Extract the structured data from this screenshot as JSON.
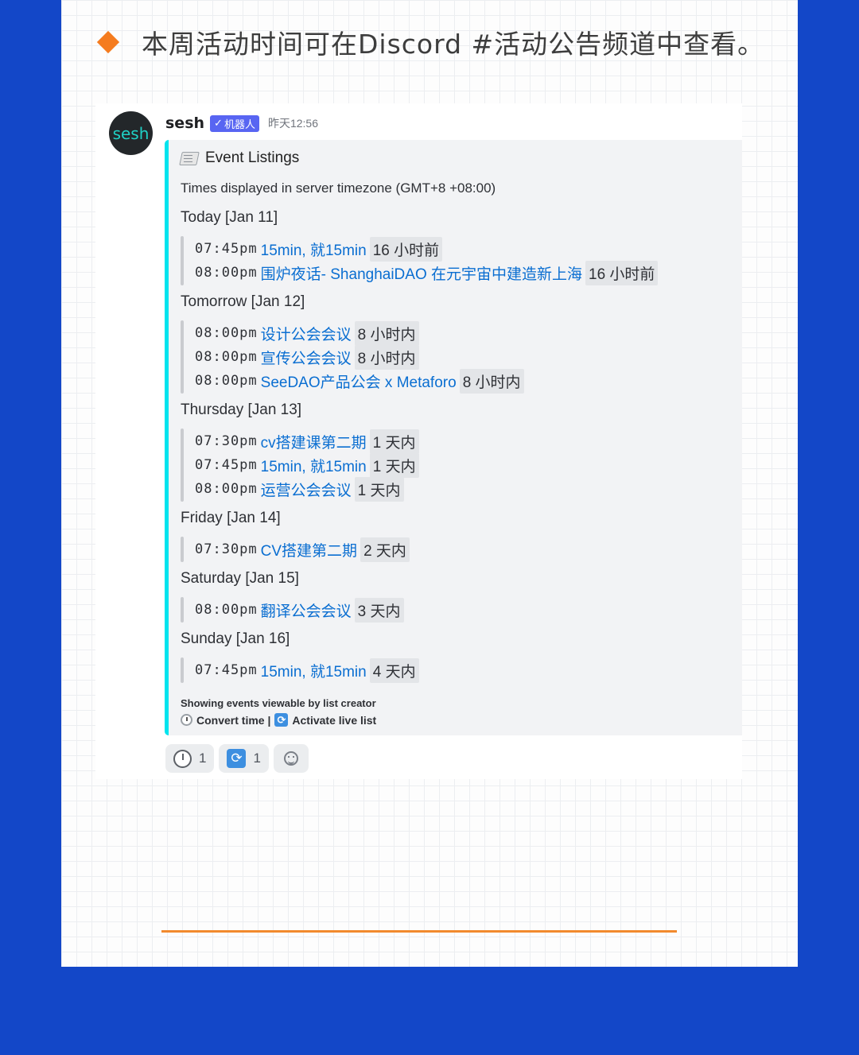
{
  "page": {
    "heading": "本周活动时间可在Discord #活动公告频道中查看。"
  },
  "message": {
    "avatar_text": "sesh",
    "bot_name": "sesh",
    "bot_tag": "机器人",
    "bot_tag_check": "✓",
    "timestamp": "昨天12:56"
  },
  "embed": {
    "title": "Event Listings",
    "description": "Times displayed in server timezone (GMT+8 +08:00)",
    "days": [
      {
        "label": "Today [Jan 11]",
        "events": [
          {
            "time": "07:45pm",
            "name": "15min, 就15min",
            "relative": "16 小时前"
          },
          {
            "time": "08:00pm",
            "name": "围炉夜话- ShanghaiDAO 在元宇宙中建造新上海",
            "relative": "16 小时前"
          }
        ]
      },
      {
        "label": "Tomorrow [Jan 12]",
        "events": [
          {
            "time": "08:00pm",
            "name": "设计公会会议",
            "relative": "8 小时内"
          },
          {
            "time": "08:00pm",
            "name": "宣传公会会议",
            "relative": "8 小时内"
          },
          {
            "time": "08:00pm",
            "name": "SeeDAO产品公会 x Metaforo",
            "relative": "8 小时内"
          }
        ]
      },
      {
        "label": "Thursday [Jan 13]",
        "events": [
          {
            "time": "07:30pm",
            "name": "cv搭建课第二期",
            "relative": "1 天内"
          },
          {
            "time": "07:45pm",
            "name": "15min, 就15min",
            "relative": "1 天内"
          },
          {
            "time": "08:00pm",
            "name": "运营公会会议",
            "relative": "1 天内"
          }
        ]
      },
      {
        "label": "Friday [Jan 14]",
        "events": [
          {
            "time": "07:30pm",
            "name": "CV搭建第二期",
            "relative": "2 天内"
          }
        ]
      },
      {
        "label": "Saturday [Jan 15]",
        "events": [
          {
            "time": "08:00pm",
            "name": "翻译公会会议",
            "relative": "3 天内"
          }
        ]
      },
      {
        "label": "Sunday [Jan 16]",
        "events": [
          {
            "time": "07:45pm",
            "name": "15min, 就15min",
            "relative": "4 天内"
          }
        ]
      }
    ],
    "footer_line1": "Showing events viewable by list creator",
    "footer_convert": "Convert time |",
    "footer_activate": "Activate live list"
  },
  "reactions": [
    {
      "icon": "clock-icon",
      "count": "1"
    },
    {
      "icon": "cycle-icon",
      "count": "1"
    }
  ],
  "colors": {
    "background": "#1347c8",
    "accent": "#f57c1f",
    "embed_bar": "#00e4ee",
    "link": "#0a6ed1",
    "bot_tag": "#5865f2"
  }
}
